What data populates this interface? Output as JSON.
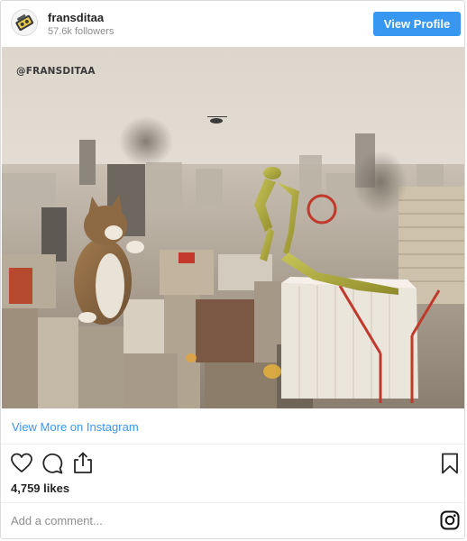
{
  "header": {
    "username": "fransditaa",
    "followers": "57.6k followers",
    "view_profile_label": "View Profile"
  },
  "photo": {
    "watermark": "@FRANSDITAA",
    "subject_icon": "city-kaiju-photo"
  },
  "view_more_label": "View More on Instagram",
  "actions": {
    "icons": [
      "heart-icon",
      "comment-icon",
      "share-icon",
      "bookmark-icon"
    ]
  },
  "likes": "4,759 likes",
  "comment": {
    "placeholder": "Add a comment..."
  },
  "colors": {
    "accent": "#3897f0",
    "text": "#262626",
    "muted": "#8e8e8e",
    "border": "#dbdbdb"
  }
}
